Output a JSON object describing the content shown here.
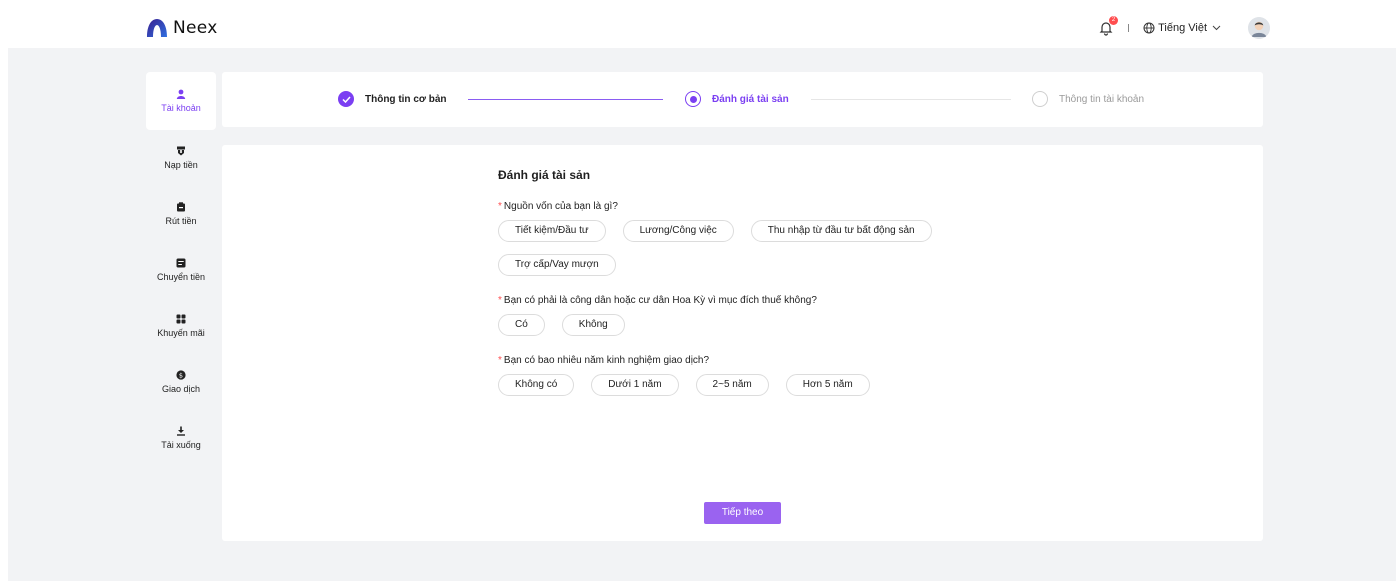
{
  "app": {
    "logo_text": "Neex"
  },
  "header": {
    "notification_count": "2",
    "language": "Tiếng Việt"
  },
  "sidebar": {
    "items": [
      {
        "label": "Tài khoản",
        "icon": "user-icon",
        "active": true
      },
      {
        "label": "Nạp tiền",
        "icon": "deposit-icon",
        "active": false
      },
      {
        "label": "Rút tiền",
        "icon": "withdraw-icon",
        "active": false
      },
      {
        "label": "Chuyển tiền",
        "icon": "transfer-icon",
        "active": false
      },
      {
        "label": "Khuyến mãi",
        "icon": "promotion-icon",
        "active": false
      },
      {
        "label": "Giao dịch",
        "icon": "transaction-icon",
        "active": false
      },
      {
        "label": "Tải xuống",
        "icon": "download-icon",
        "active": false
      }
    ]
  },
  "stepper": {
    "steps": [
      {
        "label": "Thông tin cơ bản",
        "status": "done"
      },
      {
        "label": "Đánh giá tài sản",
        "status": "current"
      },
      {
        "label": "Thông tin tài khoản",
        "status": "pending"
      }
    ]
  },
  "form": {
    "title": "Đánh giá tài sản",
    "questions": [
      {
        "label": "Nguồn vốn của bạn là gì?",
        "options": [
          "Tiết kiệm/Đầu tư",
          "Lương/Công việc",
          "Thu nhập từ đầu tư bất động sản",
          "Trợ cấp/Vay mượn"
        ]
      },
      {
        "label": "Bạn có phải là công dân hoặc cư dân Hoa Kỳ vì mục đích thuế không?",
        "options": [
          "Có",
          "Không"
        ]
      },
      {
        "label": "Bạn có bao nhiêu năm kinh nghiệm giao dịch?",
        "options": [
          "Không có",
          "Dưới 1 năm",
          "2~5 năm",
          "Hơn 5 năm"
        ]
      }
    ],
    "next_label": "Tiếp theo"
  },
  "colors": {
    "accent": "#7b3ff2",
    "button": "#9a63f0",
    "required": "#ff4d4f",
    "background": "#f2f3f5"
  }
}
